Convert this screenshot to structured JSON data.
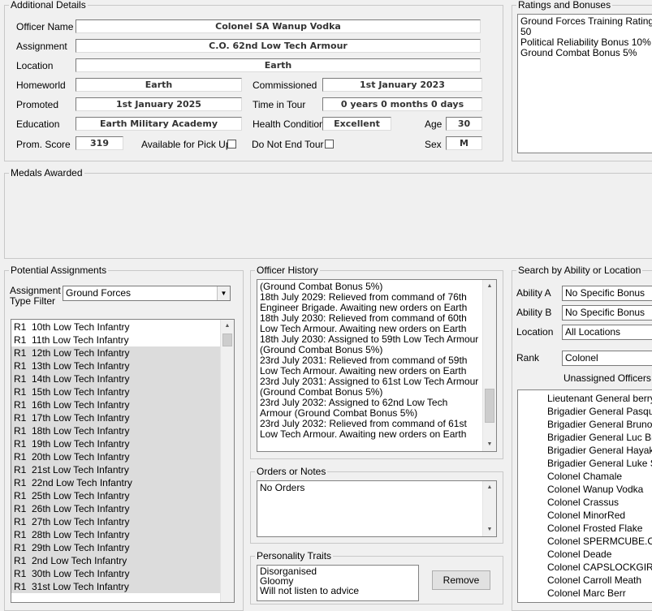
{
  "additional_details": {
    "title": "Additional Details",
    "officer_name_label": "Officer Name",
    "officer_name": "Colonel SA Wanup Vodka",
    "assignment_label": "Assignment",
    "assignment": "C.O. 62nd Low Tech Armour",
    "location_label": "Location",
    "location": "Earth",
    "homeworld_label": "Homeworld",
    "homeworld": "Earth",
    "commissioned_label": "Commissioned",
    "commissioned": "1st January 2023",
    "promoted_label": "Promoted",
    "promoted": "1st January 2025",
    "time_in_tour_label": "Time in Tour",
    "time_in_tour": "0 years 0 months 0 days",
    "education_label": "Education",
    "education": "Earth Military Academy",
    "health_label": "Health Condition",
    "health": "Excellent",
    "age_label": "Age",
    "age": "30",
    "prom_score_label": "Prom. Score",
    "prom_score": "319",
    "available_label": "Available for Pick Up",
    "do_not_end_label": "Do Not End Tour",
    "sex_label": "Sex",
    "sex": "M"
  },
  "ratings": {
    "title": "Ratings and Bonuses",
    "items": [
      "Ground Forces Training Rating 50",
      "Political Reliability Bonus 10%",
      "Ground Combat Bonus 5%"
    ]
  },
  "medals": {
    "title": "Medals Awarded"
  },
  "potential_assignments": {
    "title": "Potential Assignments",
    "filter_label_1": "Assignment",
    "filter_label_2": "Type Filter",
    "filter_value": "Ground Forces",
    "items": [
      {
        "code": "R1",
        "name": "10th Low Tech Infantry"
      },
      {
        "code": "R1",
        "name": "11th Low Tech Infantry"
      },
      {
        "code": "R1",
        "name": "12th Low Tech Infantry"
      },
      {
        "code": "R1",
        "name": "13th Low Tech Infantry"
      },
      {
        "code": "R1",
        "name": "14th Low Tech Infantry"
      },
      {
        "code": "R1",
        "name": "15th Low Tech Infantry"
      },
      {
        "code": "R1",
        "name": "16th Low Tech Infantry"
      },
      {
        "code": "R1",
        "name": "17th Low Tech Infantry"
      },
      {
        "code": "R1",
        "name": "18th Low Tech Infantry"
      },
      {
        "code": "R1",
        "name": "19th Low Tech Infantry"
      },
      {
        "code": "R1",
        "name": "20th Low Tech Infantry"
      },
      {
        "code": "R1",
        "name": "21st Low Tech Infantry"
      },
      {
        "code": "R1",
        "name": "22nd Low Tech Infantry"
      },
      {
        "code": "R1",
        "name": "25th Low Tech Infantry"
      },
      {
        "code": "R1",
        "name": "26th Low Tech Infantry"
      },
      {
        "code": "R1",
        "name": "27th Low Tech Infantry"
      },
      {
        "code": "R1",
        "name": "28th Low Tech Infantry"
      },
      {
        "code": "R1",
        "name": "29th Low Tech Infantry"
      },
      {
        "code": "R1",
        "name": "2nd Low Tech Infantry"
      },
      {
        "code": "R1",
        "name": "30th Low Tech Infantry"
      },
      {
        "code": "R1",
        "name": "31st Low Tech Infantry"
      }
    ]
  },
  "officer_history": {
    "title": "Officer History",
    "lines": [
      "(Ground Combat Bonus 5%)",
      "18th July 2029: Relieved from command of 76th Engineer Brigade. Awaiting new orders on Earth",
      "18th July 2030: Relieved from command of 60th Low Tech Armour. Awaiting new orders on Earth",
      "18th July 2030: Assigned to 59th Low Tech Armour (Ground Combat Bonus 5%)",
      "23rd July 2031: Relieved from command of 59th Low Tech Armour. Awaiting new orders on Earth",
      "23rd July 2031: Assigned to 61st Low Tech Armour (Ground Combat Bonus 5%)",
      "23rd July 2032: Assigned to 62nd Low Tech Armour (Ground Combat Bonus 5%)",
      "23rd July 2032: Relieved from command of 61st Low Tech Armour. Awaiting new orders on Earth"
    ]
  },
  "orders": {
    "title": "Orders or Notes",
    "text": "No Orders"
  },
  "personality": {
    "title": "Personality Traits",
    "items": [
      "Disorganised",
      "Gloomy",
      "Will not listen to advice"
    ],
    "remove_label": "Remove"
  },
  "search": {
    "title": "Search by Ability or Location",
    "ability_a_label": "Ability A",
    "ability_a": "No Specific Bonus",
    "ability_b_label": "Ability B",
    "ability_b": "No Specific Bonus",
    "location_label": "Location",
    "location": "All Locations",
    "rank_label": "Rank",
    "rank": "Colonel",
    "unassigned_label": "Unassigned Officers Or",
    "officers": [
      "Lieutenant General berryjor",
      "Brigadier General Pasquale",
      "Brigadier General Bruno Ro",
      "Brigadier General Luc Bisso",
      "Brigadier General Hayakaw",
      "Brigadier General Luke Ste",
      "Colonel Chamale",
      "Colonel Wanup Vodka",
      "Colonel Crassus",
      "Colonel MinorRed",
      "Colonel Frosted Flake",
      "Colonel SPERMCUBE.ORG",
      "Colonel Deade",
      "Colonel CAPSLOCKGIRL",
      "Colonel Carroll Meath",
      "Colonel Marc Berr"
    ]
  }
}
